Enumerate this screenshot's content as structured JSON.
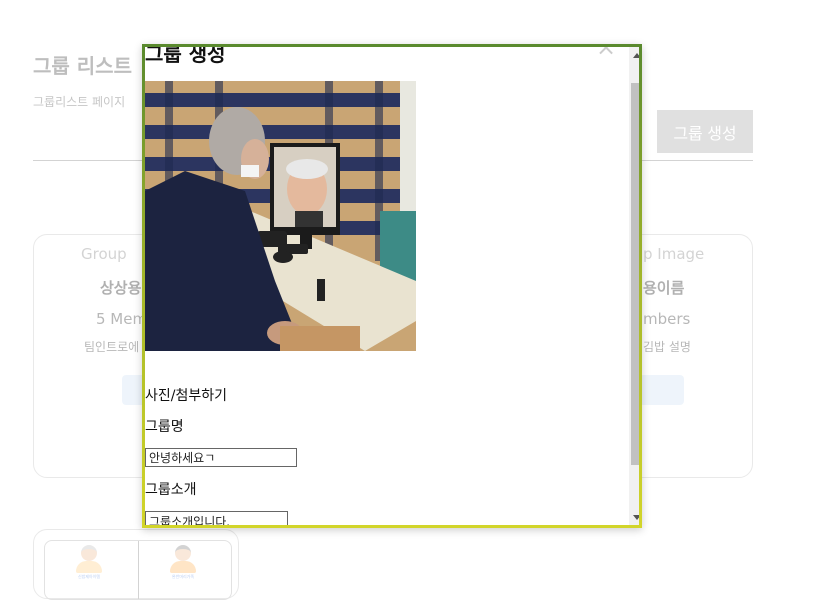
{
  "page": {
    "title": "그룹 리스트",
    "subtitle": "그룹리스트 페이지",
    "create_button": "그룹 생성"
  },
  "cards": [
    {
      "img_alt": "Group",
      "name": "상상용",
      "members": "5 Mem",
      "description": "팀인트로에"
    },
    {
      "img_alt": "p Image",
      "name": "용이름",
      "members": "mbers",
      "description": "김밥 설명"
    }
  ],
  "thumbnails": {
    "captions": [
      "신밥제아이템",
      "완반머리가족"
    ]
  },
  "modal": {
    "title": "그룹 생성",
    "close_icon": "×",
    "photo_label": "사진/첨부하기",
    "group_name_label": "그룹명",
    "group_name_value": "안녕하세요ㄱ",
    "group_intro_label": "그룹소개",
    "group_intro_value": "그룹소개입니다."
  },
  "colors": {
    "modal_border_top": "#5a8a2e",
    "modal_border_bottom": "#d2d52a",
    "button_bg": "#b7b7b7"
  }
}
